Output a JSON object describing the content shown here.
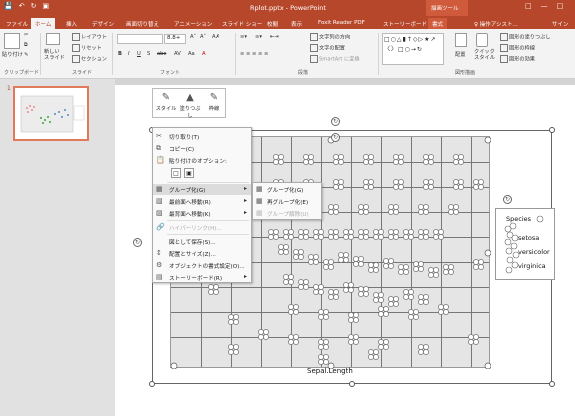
{
  "titlebar": {
    "doc_title": "Rplot.pptx - PowerPoint",
    "context_label": "描画ツール",
    "qa_icons": [
      "save-icon",
      "undo-icon",
      "redo-icon",
      "present-icon"
    ]
  },
  "tabs": [
    {
      "label": "ファイル",
      "active": false
    },
    {
      "label": "ホーム",
      "active": true
    },
    {
      "label": "挿入",
      "active": false
    },
    {
      "label": "デザイン",
      "active": false
    },
    {
      "label": "画面切り替え",
      "active": false
    },
    {
      "label": "アニメーション",
      "active": false
    },
    {
      "label": "スライド ショー",
      "active": false
    },
    {
      "label": "校閲",
      "active": false
    },
    {
      "label": "表示",
      "active": false
    },
    {
      "label": "Foxit Reader PDF",
      "active": false
    },
    {
      "label": "ストーリーボード",
      "active": false
    },
    {
      "label": "書式",
      "active": false,
      "ctx": true
    },
    {
      "label": "♀ 操作アシスト...",
      "active": false
    },
    {
      "label": "サイン",
      "active": false
    }
  ],
  "ribbon": {
    "clipboard": {
      "paste": "貼り付け",
      "label": "クリップボード"
    },
    "slides": {
      "new_slide": "新しい\nスライド",
      "layout": "レイアウト",
      "reset": "リセット",
      "section": "セクション",
      "label": "スライド"
    },
    "font": {
      "size": "8.8+",
      "label": "フォント"
    },
    "paragraph": {
      "text_direction": "文字列の方向",
      "align_text": "文字の配置",
      "smartart": "SmartArt に変換",
      "label": "段落"
    },
    "drawing": {
      "arrange": "配置",
      "quick_styles": "クイック\nスタイル",
      "shape_fill": "図形の塗りつぶし",
      "shape_outline": "図形の枠線",
      "shape_effects": "図形の効果",
      "label": "図形描画"
    }
  },
  "left_pane": {
    "slide_number": "1"
  },
  "mini_toolbar": [
    {
      "label": "スタイル",
      "icon": "style-icon"
    },
    {
      "label": "塗りつぶし",
      "icon": "fill-icon"
    },
    {
      "label": "枠線",
      "icon": "outline-icon"
    }
  ],
  "context_menu": {
    "items": [
      {
        "label": "切り取り(T)",
        "icon": "scissors-icon"
      },
      {
        "label": "コピー(C)",
        "icon": "copy-icon"
      },
      {
        "label": "貼り付けのオプション:",
        "icon": "paste-icon"
      },
      {
        "label": "グループ化(G)",
        "icon": "group-icon",
        "submenu": true
      },
      {
        "label": "最前面へ移動(R)",
        "icon": "bring-front-icon",
        "submenu": true
      },
      {
        "label": "最背面へ移動(K)",
        "icon": "send-back-icon",
        "submenu": true
      },
      {
        "label": "ハイパーリンク(H)...",
        "icon": "link-icon"
      },
      {
        "label": "図として保存(S)...",
        "icon": "save-picture-icon"
      },
      {
        "label": "配置とサイズ(Z)...",
        "icon": "size-icon"
      },
      {
        "label": "オブジェクトの書式設定(O)...",
        "icon": "format-icon"
      },
      {
        "label": "ストーリーボード(R)",
        "icon": "storyboard-icon",
        "submenu": true
      }
    ]
  },
  "submenu": {
    "items": [
      {
        "label": "グループ化(G)"
      },
      {
        "label": "再グループ化(E)"
      },
      {
        "label": "グループ解除(U)"
      }
    ]
  },
  "chart": {
    "xlabel": "Sepal.Length",
    "legend_title": "Species",
    "legend_items": [
      "setosa",
      "versicolor",
      "virginica"
    ]
  }
}
